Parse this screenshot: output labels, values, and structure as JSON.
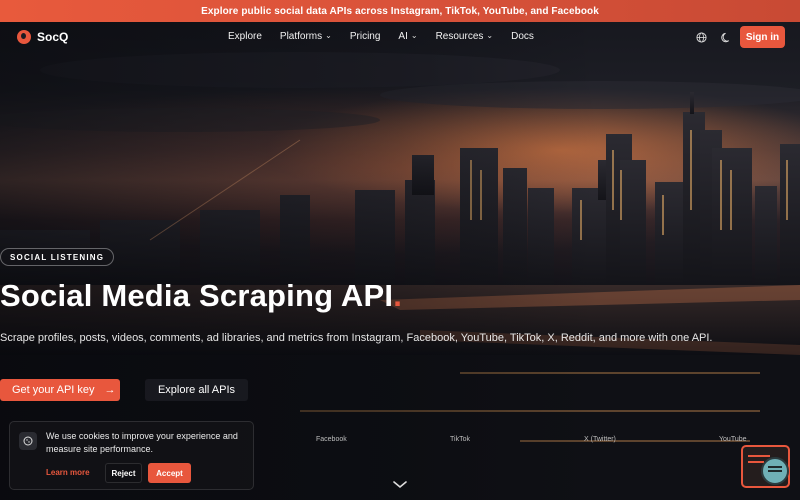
{
  "announcement": "Explore public social data APIs across Instagram, TikTok, YouTube, and Facebook",
  "brand": {
    "name": "SocQ",
    "accent": "#e8573d"
  },
  "nav": {
    "items": [
      {
        "label": "Explore",
        "dropdown": false
      },
      {
        "label": "Platforms",
        "dropdown": true
      },
      {
        "label": "Pricing",
        "dropdown": false
      },
      {
        "label": "AI",
        "dropdown": true
      },
      {
        "label": "Resources",
        "dropdown": true
      },
      {
        "label": "Docs",
        "dropdown": false
      }
    ],
    "icons": [
      "globe-icon",
      "moon-icon"
    ],
    "signin": "Sign in"
  },
  "hero": {
    "badge": "SOCIAL LISTENING",
    "title": "Social Media Scraping API",
    "title_dot": ".",
    "subtitle": "Scrape profiles, posts, videos, comments, ad libraries, and metrics from Instagram, Facebook, YouTube, TikTok, X, Reddit, and more with one API.",
    "cta_primary": "Get your API key",
    "cta_primary_icon": "→",
    "cta_secondary": "Explore all APIs"
  },
  "platforms": [
    "Facebook",
    "TikTok",
    "X (Twitter)",
    "YouTube"
  ],
  "cookie": {
    "text": "We use cookies to improve your experience and measure site performance.",
    "learn_more": "Learn more",
    "reject": "Reject",
    "accept": "Accept"
  }
}
